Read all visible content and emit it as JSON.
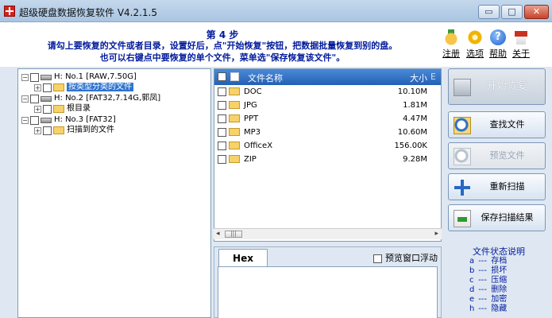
{
  "window": {
    "title": "超级硬盘数据恢复软件 V4.2.1.5",
    "controls": {
      "minimize": "▭",
      "maximize": "□",
      "close": "✕"
    }
  },
  "header": {
    "step_title": "第 4 步",
    "instruction_line1": "请勾上要恢复的文件或者目录，设置好后，点\"开始恢复\"按钮，把数据批量恢复到别的盘。",
    "instruction_line2": "也可以右键点中要恢复的单个文件，菜单选\"保存恢复该文件\"。",
    "tools": [
      {
        "label": "注册",
        "icon": "register-icon"
      },
      {
        "label": "选项",
        "icon": "options-icon"
      },
      {
        "label": "帮助",
        "icon": "help-icon",
        "glyph": "?"
      },
      {
        "label": "关于",
        "icon": "about-icon"
      }
    ]
  },
  "tree": {
    "expander_collapsed": "+",
    "expander_expanded": "−",
    "items": [
      {
        "label": "H: No.1 [RAW,7.50G]",
        "type": "drive"
      },
      {
        "label": "按类型分类的文件",
        "type": "folder",
        "selected": true
      },
      {
        "label": "H: No.2 [FAT32,7.14G,郭凤]",
        "type": "drive"
      },
      {
        "label": "根目录",
        "type": "folder"
      },
      {
        "label": "H: No.3 [FAT32]",
        "type": "drive"
      },
      {
        "label": "扫描到的文件",
        "type": "folder"
      }
    ]
  },
  "file_list": {
    "columns": {
      "name": "文件名称",
      "size": "大小",
      "extra": "E"
    },
    "rows": [
      {
        "name": "DOC",
        "size": "10.10M"
      },
      {
        "name": "JPG",
        "size": "1.81M"
      },
      {
        "name": "PPT",
        "size": "4.47M"
      },
      {
        "name": "MP3",
        "size": "10.60M"
      },
      {
        "name": "OfficeX",
        "size": "156.00K"
      },
      {
        "name": "ZIP",
        "size": "9.28M"
      }
    ],
    "scroll": {
      "left": "◂",
      "right": "▸",
      "thumb": "|||"
    }
  },
  "hex": {
    "tab_label": "Hex",
    "float_label": "预览窗口浮动"
  },
  "side_buttons": {
    "start_recovery": "开始恢复",
    "view_file": "查找文件",
    "preview_file": "预览文件",
    "rescan": "重新扫描",
    "save_scan": "保存扫描结果"
  },
  "legend": {
    "title": "文件状态说明",
    "items": [
      {
        "code": "a",
        "desc": "存档"
      },
      {
        "code": "b",
        "desc": "损坏"
      },
      {
        "code": "c",
        "desc": "压缩"
      },
      {
        "code": "d",
        "desc": "删除"
      },
      {
        "code": "e",
        "desc": "加密"
      },
      {
        "code": "h",
        "desc": "隐藏"
      }
    ],
    "separator": "---"
  }
}
